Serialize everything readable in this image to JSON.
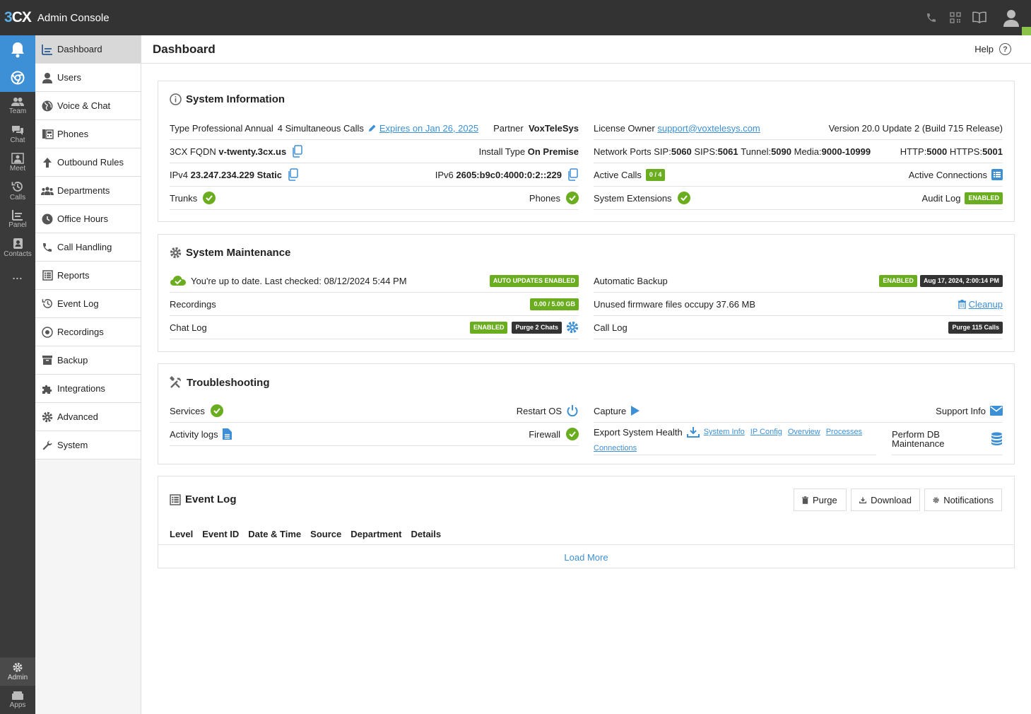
{
  "app": {
    "logo_3": "3",
    "logo_cx": "CX",
    "title": "Admin Console"
  },
  "rail": {
    "items": [
      {
        "label": "",
        "icon": "bell-icon"
      },
      {
        "label": "",
        "icon": "chrome-icon"
      },
      {
        "label": "Team",
        "icon": "team-icon"
      },
      {
        "label": "Chat",
        "icon": "chat-icon"
      },
      {
        "label": "Meet",
        "icon": "meet-icon"
      },
      {
        "label": "Calls",
        "icon": "history-icon"
      },
      {
        "label": "Panel",
        "icon": "panel-icon"
      },
      {
        "label": "Contacts",
        "icon": "contacts-icon"
      },
      {
        "label": "...",
        "icon": "more-icon"
      }
    ],
    "bottom": [
      {
        "label": "Admin",
        "icon": "gear-icon"
      },
      {
        "label": "Apps",
        "icon": "apps-icon"
      }
    ]
  },
  "nav": {
    "items": [
      {
        "label": "Dashboard",
        "icon": "chart-icon"
      },
      {
        "label": "Users",
        "icon": "user-icon"
      },
      {
        "label": "Voice & Chat",
        "icon": "globe-icon"
      },
      {
        "label": "Phones",
        "icon": "phones-icon"
      },
      {
        "label": "Outbound Rules",
        "icon": "arrow-up-icon"
      },
      {
        "label": "Departments",
        "icon": "departments-icon"
      },
      {
        "label": "Office Hours",
        "icon": "clock-icon"
      },
      {
        "label": "Call Handling",
        "icon": "phone-icon"
      },
      {
        "label": "Reports",
        "icon": "reports-icon"
      },
      {
        "label": "Event Log",
        "icon": "history-icon"
      },
      {
        "label": "Recordings",
        "icon": "record-icon"
      },
      {
        "label": "Backup",
        "icon": "archive-icon"
      },
      {
        "label": "Integrations",
        "icon": "puzzle-icon"
      },
      {
        "label": "Advanced",
        "icon": "gear-icon"
      },
      {
        "label": "System",
        "icon": "wrench-icon"
      }
    ]
  },
  "page": {
    "title": "Dashboard",
    "help": "Help",
    "help_glyph": "?"
  },
  "sysinfo": {
    "title": "System Information",
    "type_label": "Type",
    "type_value": "Professional Annual",
    "calls": "4 Simultaneous Calls",
    "expires": "Expires on Jan 26, 2025",
    "partner_label": "Partner",
    "partner_value": "VoxTeleSys",
    "license_owner_label": "License Owner",
    "license_owner_value": "support@voxtelesys.com",
    "version": "Version 20.0 Update 2 (Build 715 Release)",
    "fqdn_label": "3CX FQDN",
    "fqdn_value": "v-twenty.3cx.us",
    "install_label": "Install Type",
    "install_value": "On Premise",
    "ports_label": "Network Ports",
    "sip_label": "SIP:",
    "sip_value": "5060",
    "sips_label": "SIPS:",
    "sips_value": "5061",
    "tunnel_label": "Tunnel:",
    "tunnel_value": "5090",
    "media_label": "Media:",
    "media_value": "9000-10999",
    "http_label": "HTTP:",
    "http_value": "5000",
    "https_label": "HTTPS:",
    "https_value": "5001",
    "ipv4_label": "IPv4",
    "ipv4_value": "23.247.234.229 Static",
    "ipv6_label": "IPv6",
    "ipv6_value": "2605:b9c0:4000:0:2::229",
    "active_calls_label": "Active Calls",
    "active_calls_value": "0 / 4",
    "active_connections_label": "Active Connections",
    "trunks_label": "Trunks",
    "phones_label": "Phones",
    "extensions_label": "System Extensions",
    "audit_label": "Audit Log",
    "audit_value": "ENABLED"
  },
  "maintenance": {
    "title": "System Maintenance",
    "update_text": "You're up to date. Last checked: 08/12/2024 5:44 PM",
    "auto_updates": "AUTO UPDATES ENABLED",
    "backup_label": "Automatic Backup",
    "backup_status": "ENABLED",
    "backup_date": "Aug 17, 2024, 2:00:14 PM",
    "recordings_label": "Recordings",
    "recordings_value": "0.00 / 5.00 GB",
    "firmware_text": "Unused firmware files occupy 37.66 MB",
    "cleanup": "Cleanup",
    "chatlog_label": "Chat Log",
    "chatlog_status": "ENABLED",
    "purge_chats": "Purge 2 Chats",
    "calllog_label": "Call Log",
    "purge_calls": "Purge 115 Calls"
  },
  "troubleshooting": {
    "title": "Troubleshooting",
    "services": "Services",
    "restart": "Restart OS",
    "capture": "Capture",
    "support": "Support Info",
    "activity": "Activity logs",
    "firewall": "Firewall",
    "export": "Export System Health",
    "export_links": [
      "System Info",
      "IP Config",
      "Overview",
      "Processes"
    ],
    "connections": "Connections",
    "perform_db": "Perform DB Maintenance"
  },
  "eventlog": {
    "title": "Event Log",
    "purge": "Purge",
    "download": "Download",
    "notifications": "Notifications",
    "columns": [
      "Level",
      "Event ID",
      "Date & Time",
      "Source",
      "Department",
      "Details"
    ],
    "load_more": "Load More"
  },
  "colors": {
    "topbar": "#333333",
    "accent": "#3d8fd6",
    "success": "#6aae1f"
  }
}
